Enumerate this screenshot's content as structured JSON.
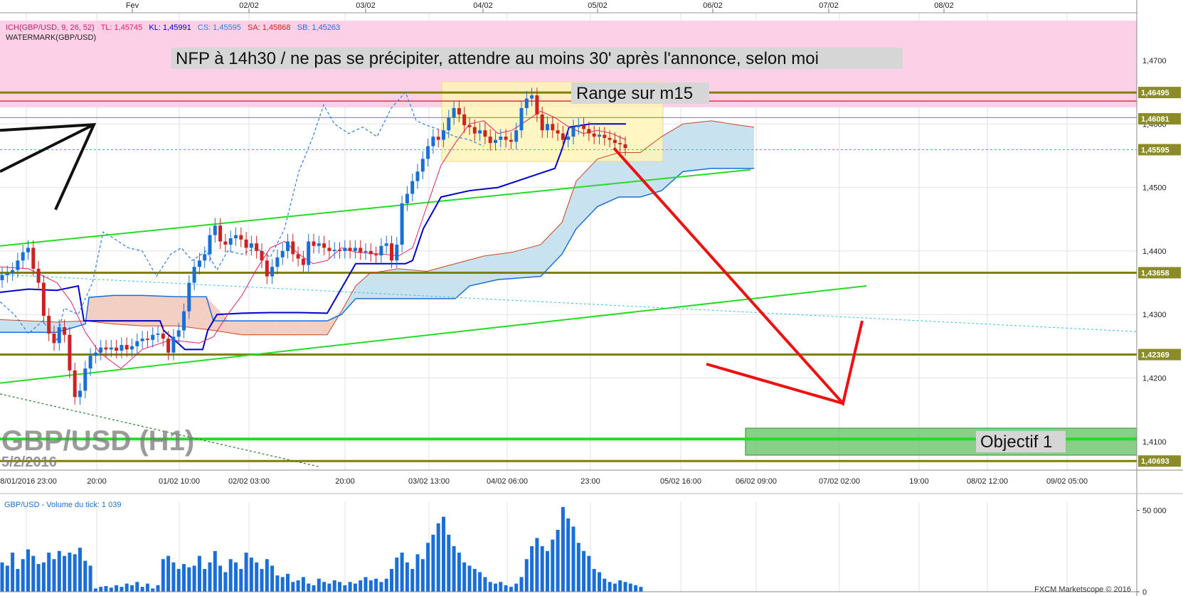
{
  "chart_data": {
    "type": "candlestick",
    "instrument": "GBP/USD",
    "watermark": {
      "title": "GBP/USD (H1)",
      "date": "5/2/2016"
    },
    "indicator_legend": {
      "ich": "ICH(GBP/USD, 9, 26, 52)",
      "tl": "TL: 1,45745",
      "kl": "KL: 1,45991",
      "cs": "CS: 1,45595",
      "sa": "SA: 1,45868",
      "sb": "SB: 1,45263",
      "watermark": "WATERMARK(GBP/USD)"
    },
    "top_date_labels": [
      "Fev",
      "02/02",
      "03/02",
      "04/02",
      "05/02",
      "06/02",
      "07/02",
      "08/02"
    ],
    "x_tick_labels": [
      "28/01/2016 23:00",
      "20:00",
      "01/02 10:00",
      "02/02 03:00",
      "20:00",
      "03/02 13:00",
      "04/02 06:00",
      "23:00",
      "05/02 16:00",
      "06/02 09:00",
      "07/02 02:00",
      "19:00",
      "08/02 12:00",
      "09/02 05:00"
    ],
    "y_axis": {
      "range": [
        1.4055,
        1.4775
      ],
      "ticks": [
        "1,4700",
        "1,4600",
        "1,4500",
        "1,4400",
        "1,4300",
        "1,4200",
        "1,4100"
      ]
    },
    "price_markers": [
      "1,46495",
      "1,46081",
      "1,45595",
      "1,43658",
      "1,42369",
      "1,40693"
    ],
    "horizontal_levels": [
      1.46495,
      1.43658,
      1.42369,
      1.40693
    ],
    "annotations": {
      "nfp_note": "NFP à 14h30 / ne pas se précipiter, attendre au moins 30' après l'annonce, selon moi",
      "range_note": "Range sur m15",
      "objective_note": "Objectif 1"
    },
    "candles_close": [
      1.4362,
      1.4365,
      1.437,
      1.4385,
      1.4398,
      1.4405,
      1.4372,
      1.435,
      1.4298,
      1.427,
      1.4255,
      1.428,
      1.4268,
      1.4212,
      1.417,
      1.418,
      1.4215,
      1.4235,
      1.424,
      1.4248,
      1.4245,
      1.4248,
      1.4243,
      1.4252,
      1.4245,
      1.425,
      1.4258,
      1.4262,
      1.426,
      1.4268,
      1.427,
      1.4262,
      1.424,
      1.4265,
      1.4275,
      1.4305,
      1.435,
      1.4375,
      1.4385,
      1.4395,
      1.4425,
      1.444,
      1.4415,
      1.441,
      1.442,
      1.4425,
      1.4418,
      1.4405,
      1.4412,
      1.44,
      1.4385,
      1.436,
      1.4375,
      1.439,
      1.44,
      1.4415,
      1.4395,
      1.4388,
      1.4378,
      1.4415,
      1.4408,
      1.4412,
      1.4405,
      1.44,
      1.4402,
      1.44,
      1.4405,
      1.44,
      1.4405,
      1.4398,
      1.44,
      1.4395,
      1.4393,
      1.4408,
      1.4412,
      1.4385,
      1.441,
      1.4475,
      1.449,
      1.451,
      1.4525,
      1.4545,
      1.4565,
      1.458,
      1.4575,
      1.459,
      1.461,
      1.4625,
      1.4615,
      1.4598,
      1.4595,
      1.4585,
      1.459,
      1.458,
      1.457,
      1.4575,
      1.458,
      1.4575,
      1.4572,
      1.459,
      1.4625,
      1.464,
      1.4645,
      1.4615,
      1.459,
      1.46,
      1.459,
      1.4585,
      1.4575,
      1.458,
      1.4595,
      1.4598,
      1.4592,
      1.4585,
      1.458,
      1.4583,
      1.4578,
      1.4575,
      1.457,
      1.4568,
      1.4562
    ],
    "volume_label": "GBP/USD - Volume du tick: 1 039",
    "volume_axis": {
      "range": [
        0,
        55000
      ],
      "ticks": [
        "50 000",
        "0"
      ]
    },
    "volume_values": [
      18000,
      16000,
      24000,
      14000,
      20000,
      26000,
      22000,
      17000,
      18000,
      24000,
      20000,
      25000,
      22000,
      24000,
      23000,
      27000,
      19000,
      16000,
      2000,
      3000,
      3500,
      2500,
      4000,
      3000,
      5000,
      4000,
      6000,
      3000,
      5000,
      2000,
      4000,
      20000,
      22000,
      18000,
      14000,
      17000,
      15000,
      16000,
      22000,
      14000,
      18000,
      25000,
      16000,
      12000,
      20000,
      18000,
      14000,
      24000,
      21000,
      18000,
      14000,
      20000,
      16000,
      10000,
      9000,
      11000,
      6000,
      7000,
      9000,
      5000,
      4000,
      8000,
      6000,
      5000,
      7000,
      6000,
      4000,
      6000,
      5000,
      7000,
      9000,
      7000,
      8000,
      6000,
      8000,
      14000,
      21000,
      24000,
      18000,
      14000,
      23000,
      20000,
      30000,
      35000,
      42000,
      46000,
      35000,
      28000,
      24000,
      18000,
      16000,
      14000,
      12000,
      9000,
      6000,
      5000,
      6000,
      4000,
      3000,
      5000,
      9000,
      20000,
      28000,
      33000,
      28000,
      25000,
      32000,
      38000,
      52000,
      45000,
      40000,
      30000,
      25000,
      22000,
      14000,
      12000,
      8000,
      6000,
      5000,
      7000,
      6000,
      5000,
      4000,
      3000
    ],
    "copyright": "FXCM Marketscope © 2016"
  },
  "colors": {
    "bull": "#1a6fd6",
    "bear": "#cc2222",
    "kijun": "#0000cc",
    "tenkan": "#e0206a",
    "chikou": "#2f7fe0",
    "cloud_bull": "#c9e2f0",
    "cloud_bear": "#f3cfc3",
    "trend_green": "#22dd22",
    "level_olive": "#808000",
    "arrow_red": "#ee1111",
    "pink_zone": "#fcd0e6",
    "range_box": "#fff5b8",
    "objective_box": "#6cc36c"
  }
}
